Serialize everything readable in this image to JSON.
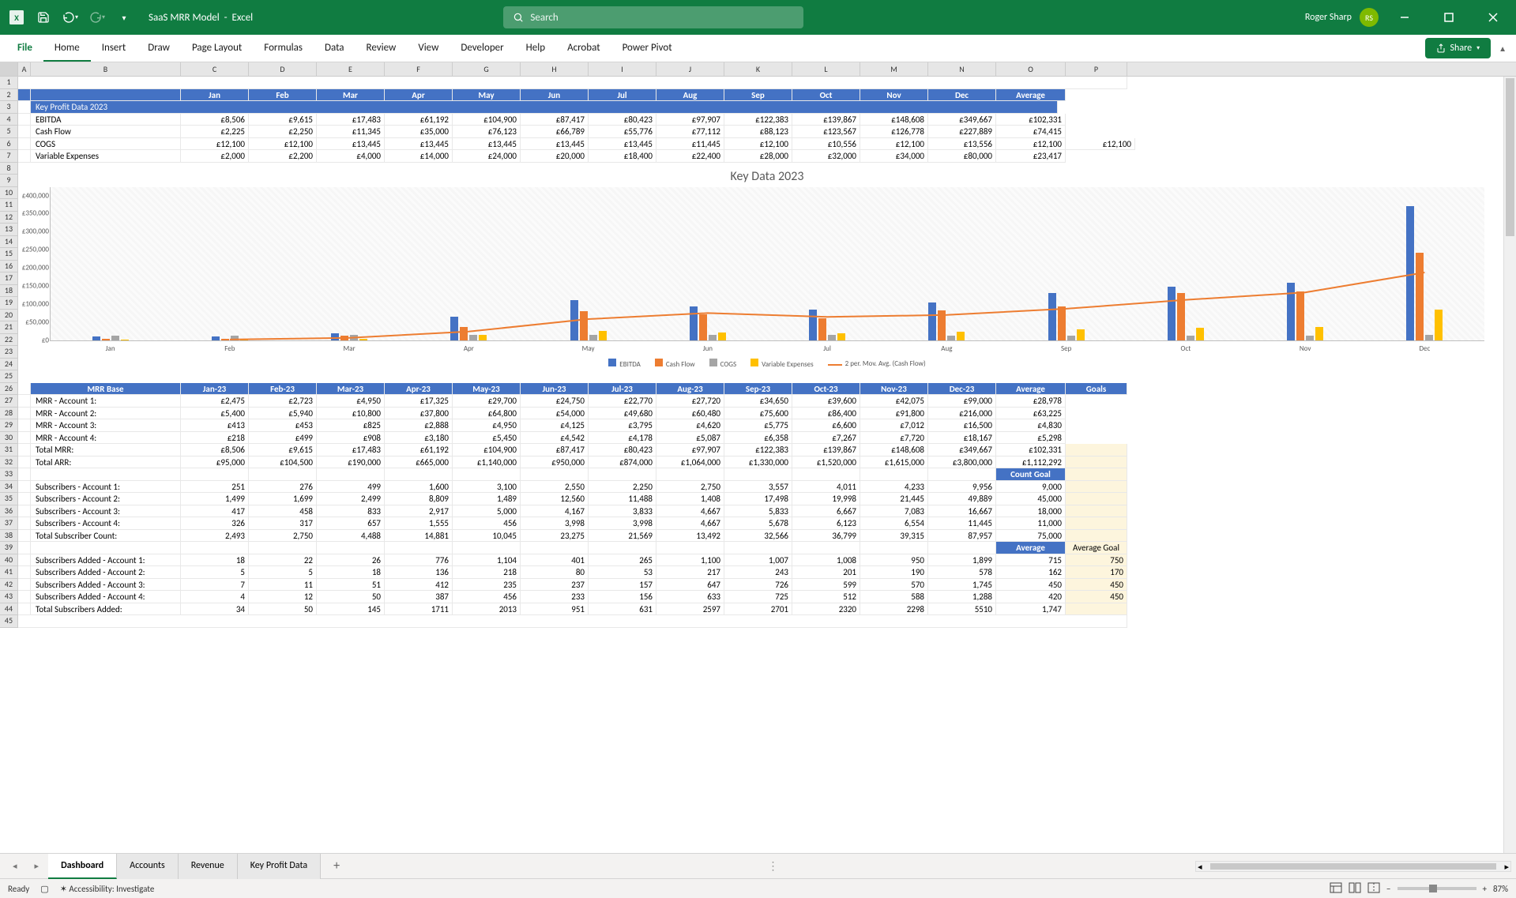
{
  "titlebar": {
    "docname": "SaaS MRR Model",
    "appname": "Excel",
    "search_placeholder": "Search",
    "user_name": "Roger Sharp",
    "user_initials": "RS"
  },
  "ribbon": {
    "tabs": [
      "File",
      "Home",
      "Insert",
      "Draw",
      "Page Layout",
      "Formulas",
      "Data",
      "Review",
      "View",
      "Developer",
      "Help",
      "Acrobat",
      "Power Pivot"
    ],
    "share_label": "Share"
  },
  "columns_letters": [
    "A",
    "B",
    "C",
    "D",
    "E",
    "F",
    "G",
    "H",
    "I",
    "J",
    "K",
    "L",
    "M",
    "N",
    "O",
    "P"
  ],
  "months": [
    "Jan",
    "Feb",
    "Mar",
    "Apr",
    "May",
    "Jun",
    "Jul",
    "Aug",
    "Sep",
    "Oct",
    "Nov",
    "Dec",
    "Average"
  ],
  "section1_title": "Key Profit Data 2023",
  "section1_rows": [
    {
      "label": "EBITDA",
      "vals": [
        "£8,506",
        "£9,615",
        "£17,483",
        "£61,192",
        "£104,900",
        "£87,417",
        "£80,423",
        "£97,907",
        "£122,383",
        "£139,867",
        "£148,608",
        "£349,667",
        "£102,331"
      ]
    },
    {
      "label": "Cash Flow",
      "vals": [
        "£2,225",
        "£2,250",
        "£11,345",
        "£35,000",
        "£76,123",
        "£66,789",
        "£55,776",
        "£77,112",
        "£88,123",
        "£123,567",
        "£126,778",
        "£227,889",
        "£74,415"
      ]
    },
    {
      "label": "COGS",
      "vals": [
        "£12,100",
        "£12,100",
        "£13,445",
        "£13,445",
        "£13,445",
        "£13,445",
        "£13,445",
        "£11,445",
        "£12,100",
        "£10,556",
        "£12,100",
        "£13,556",
        "£12,100",
        "£12,100"
      ]
    },
    {
      "label": "Variable Expenses",
      "vals": [
        "£2,000",
        "£2,200",
        "£4,000",
        "£14,000",
        "£24,000",
        "£20,000",
        "£18,400",
        "£22,400",
        "£28,000",
        "£32,000",
        "£34,000",
        "£80,000",
        "£23,417"
      ]
    }
  ],
  "mrr_header_months": [
    "Jan-23",
    "Feb-23",
    "Mar-23",
    "Apr-23",
    "May-23",
    "Jun-23",
    "Jul-23",
    "Aug-23",
    "Sep-23",
    "Oct-23",
    "Nov-23",
    "Dec-23",
    "Average",
    "Goals"
  ],
  "mrr_header_label": "MRR Base",
  "mrr_rows": [
    {
      "label": "MRR - Account 1:",
      "vals": [
        "£2,475",
        "£2,723",
        "£4,950",
        "£17,325",
        "£29,700",
        "£24,750",
        "£22,770",
        "£27,720",
        "£34,650",
        "£39,600",
        "£42,075",
        "£99,000",
        "£28,978"
      ]
    },
    {
      "label": "MRR - Account 2:",
      "vals": [
        "£5,400",
        "£5,940",
        "£10,800",
        "£37,800",
        "£64,800",
        "£54,000",
        "£49,680",
        "£60,480",
        "£75,600",
        "£86,400",
        "£91,800",
        "£216,000",
        "£63,225"
      ]
    },
    {
      "label": "MRR - Account 3:",
      "vals": [
        "£413",
        "£453",
        "£825",
        "£2,888",
        "£4,950",
        "£4,125",
        "£3,795",
        "£4,620",
        "£5,775",
        "£6,600",
        "£7,012",
        "£16,500",
        "£4,830"
      ]
    },
    {
      "label": "MRR - Account 4:",
      "vals": [
        "£218",
        "£499",
        "£908",
        "£3,180",
        "£5,450",
        "£4,542",
        "£4,178",
        "£5,087",
        "£6,358",
        "£7,267",
        "£7,720",
        "£18,167",
        "£5,298"
      ]
    },
    {
      "label": "Total MRR:",
      "vals": [
        "£8,506",
        "£9,615",
        "£17,483",
        "£61,192",
        "£104,900",
        "£87,417",
        "£80,423",
        "£97,907",
        "£122,383",
        "£139,867",
        "£148,608",
        "£349,667",
        "£102,331"
      ]
    },
    {
      "label": "Total ARR:",
      "vals": [
        "£95,000",
        "£104,500",
        "£190,000",
        "£665,000",
        "£1,140,000",
        "£950,000",
        "£874,000",
        "£1,064,000",
        "£1,330,000",
        "£1,520,000",
        "£1,615,000",
        "£3,800,000",
        "£1,112,292"
      ]
    }
  ],
  "count_goal_label": "Count Goal",
  "sub_rows": [
    {
      "label": "Subscribers - Account 1:",
      "vals": [
        "251",
        "276",
        "499",
        "1,600",
        "3,100",
        "2,550",
        "2,250",
        "2,750",
        "3,557",
        "4,011",
        "4,233",
        "9,956",
        "9,000"
      ]
    },
    {
      "label": "Subscribers - Account 2:",
      "vals": [
        "1,499",
        "1,699",
        "2,499",
        "8,809",
        "1,489",
        "12,560",
        "11,488",
        "1,408",
        "17,498",
        "19,998",
        "21,445",
        "49,889",
        "45,000"
      ]
    },
    {
      "label": "Subscribers - Account 3:",
      "vals": [
        "417",
        "458",
        "833",
        "2,917",
        "5,000",
        "4,167",
        "3,833",
        "4,667",
        "5,833",
        "6,667",
        "7,083",
        "16,667",
        "18,000"
      ]
    },
    {
      "label": "Subscribers - Account 4:",
      "vals": [
        "326",
        "317",
        "657",
        "1,555",
        "456",
        "3,998",
        "3,998",
        "4,667",
        "5,678",
        "6,123",
        "6,554",
        "11,445",
        "11,000"
      ]
    },
    {
      "label": "Total Subscriber Count:",
      "vals": [
        "2,493",
        "2,750",
        "4,488",
        "14,881",
        "10,045",
        "23,275",
        "21,569",
        "13,492",
        "32,566",
        "36,799",
        "39,315",
        "87,957",
        "75,000"
      ]
    }
  ],
  "avg_label": "Average",
  "avg_goal_label": "Average Goal",
  "added_rows": [
    {
      "label": "Subscribers Added - Account 1:",
      "vals": [
        "18",
        "22",
        "26",
        "776",
        "1,104",
        "401",
        "265",
        "1,100",
        "1,007",
        "1,008",
        "950",
        "1,899",
        "715",
        "750"
      ]
    },
    {
      "label": "Subscribers Added - Account 2:",
      "vals": [
        "5",
        "5",
        "18",
        "136",
        "218",
        "80",
        "53",
        "217",
        "243",
        "201",
        "190",
        "578",
        "162",
        "170"
      ]
    },
    {
      "label": "Subscribers Added - Account 3:",
      "vals": [
        "7",
        "11",
        "51",
        "412",
        "235",
        "237",
        "157",
        "647",
        "726",
        "599",
        "570",
        "1,745",
        "450",
        "450"
      ]
    },
    {
      "label": "Subscribers Added - Account 4:",
      "vals": [
        "4",
        "12",
        "50",
        "387",
        "456",
        "233",
        "156",
        "633",
        "725",
        "512",
        "588",
        "1,288",
        "420",
        "450"
      ]
    },
    {
      "label": "Total Subscribers Added:",
      "vals": [
        "34",
        "50",
        "145",
        "1711",
        "2013",
        "951",
        "631",
        "2597",
        "2701",
        "2320",
        "2298",
        "5510",
        "1,747",
        ""
      ]
    }
  ],
  "chart_data": {
    "type": "bar",
    "title": "Key Data 2023",
    "xlabel": "",
    "ylabel": "",
    "ylim": [
      0,
      400000
    ],
    "categories": [
      "Jan",
      "Feb",
      "Mar",
      "Apr",
      "May",
      "Jun",
      "Jul",
      "Aug",
      "Sep",
      "Oct",
      "Nov",
      "Dec"
    ],
    "series": [
      {
        "name": "EBITDA",
        "values": [
          8506,
          9615,
          17483,
          61192,
          104900,
          87417,
          80423,
          97907,
          122383,
          139867,
          148608,
          349667
        ],
        "color": "#4472c4"
      },
      {
        "name": "Cash Flow",
        "values": [
          2225,
          2250,
          11345,
          35000,
          76123,
          66789,
          55776,
          77112,
          88123,
          123567,
          126778,
          227889
        ],
        "color": "#ed7d31"
      },
      {
        "name": "COGS",
        "values": [
          12100,
          12100,
          13445,
          13445,
          13445,
          13445,
          13445,
          11445,
          12100,
          10556,
          12100,
          13556
        ],
        "color": "#a5a5a5"
      },
      {
        "name": "Variable Expenses",
        "values": [
          2000,
          2200,
          4000,
          14000,
          24000,
          20000,
          18400,
          22400,
          28000,
          32000,
          34000,
          80000
        ],
        "color": "#ffc000"
      }
    ],
    "trendline": {
      "name": "2 per. Mov. Avg. (Cash Flow)",
      "color": "#ed7d31"
    },
    "y_ticks": [
      "£0",
      "£50,000",
      "£100,000",
      "£150,000",
      "£200,000",
      "£250,000",
      "£300,000",
      "£350,000",
      "£400,000"
    ]
  },
  "sheets": {
    "tabs": [
      "Dashboard",
      "Accounts",
      "Revenue",
      "Key Profit Data"
    ],
    "active": 0
  },
  "status": {
    "ready": "Ready",
    "access": "Accessibility: Investigate",
    "zoom": "87%"
  }
}
